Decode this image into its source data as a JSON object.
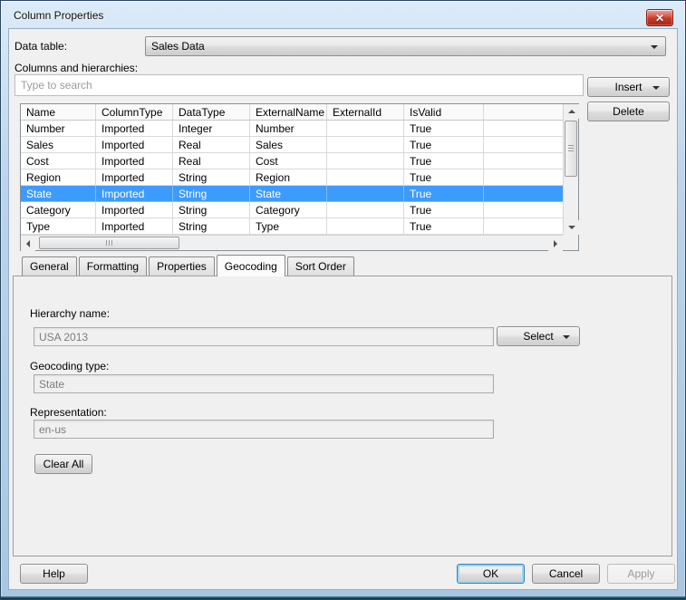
{
  "window": {
    "title": "Column Properties"
  },
  "data_table": {
    "label": "Data table:",
    "value": "Sales Data"
  },
  "columns_section": {
    "label": "Columns and hierarchies:",
    "search_placeholder": "Type to search",
    "insert_label": "Insert",
    "delete_label": "Delete"
  },
  "table": {
    "headers": [
      "Name",
      "ColumnType",
      "DataType",
      "ExternalName",
      "ExternalId",
      "IsValid"
    ],
    "rows": [
      {
        "cells": [
          "Number",
          "Imported",
          "Integer",
          "Number",
          "",
          "True"
        ],
        "selected": false
      },
      {
        "cells": [
          "Sales",
          "Imported",
          "Real",
          "Sales",
          "",
          "True"
        ],
        "selected": false
      },
      {
        "cells": [
          "Cost",
          "Imported",
          "Real",
          "Cost",
          "",
          "True"
        ],
        "selected": false
      },
      {
        "cells": [
          "Region",
          "Imported",
          "String",
          "Region",
          "",
          "True"
        ],
        "selected": false
      },
      {
        "cells": [
          "State",
          "Imported",
          "String",
          "State",
          "",
          "True"
        ],
        "selected": true
      },
      {
        "cells": [
          "Category",
          "Imported",
          "String",
          "Category",
          "",
          "True"
        ],
        "selected": false
      },
      {
        "cells": [
          "Type",
          "Imported",
          "String",
          "Type",
          "",
          "True"
        ],
        "selected": false
      }
    ]
  },
  "tabs": [
    {
      "label": "General",
      "active": false
    },
    {
      "label": "Formatting",
      "active": false
    },
    {
      "label": "Properties",
      "active": false
    },
    {
      "label": "Geocoding",
      "active": true
    },
    {
      "label": "Sort Order",
      "active": false
    }
  ],
  "geocoding_tab": {
    "hierarchy_name": {
      "label": "Hierarchy name:",
      "value": "USA 2013"
    },
    "select_button": "Select",
    "geocoding_type": {
      "label": "Geocoding type:",
      "value": "State"
    },
    "representation": {
      "label": "Representation:",
      "value": "en-us"
    },
    "clear_all_button": "Clear All"
  },
  "footer": {
    "help": "Help",
    "ok": "OK",
    "cancel": "Cancel",
    "apply": "Apply"
  },
  "colors": {
    "selection_blue": "#3d9bfd",
    "titlebar_blue": "#bdd4ea",
    "close_red": "#c53b2b"
  }
}
